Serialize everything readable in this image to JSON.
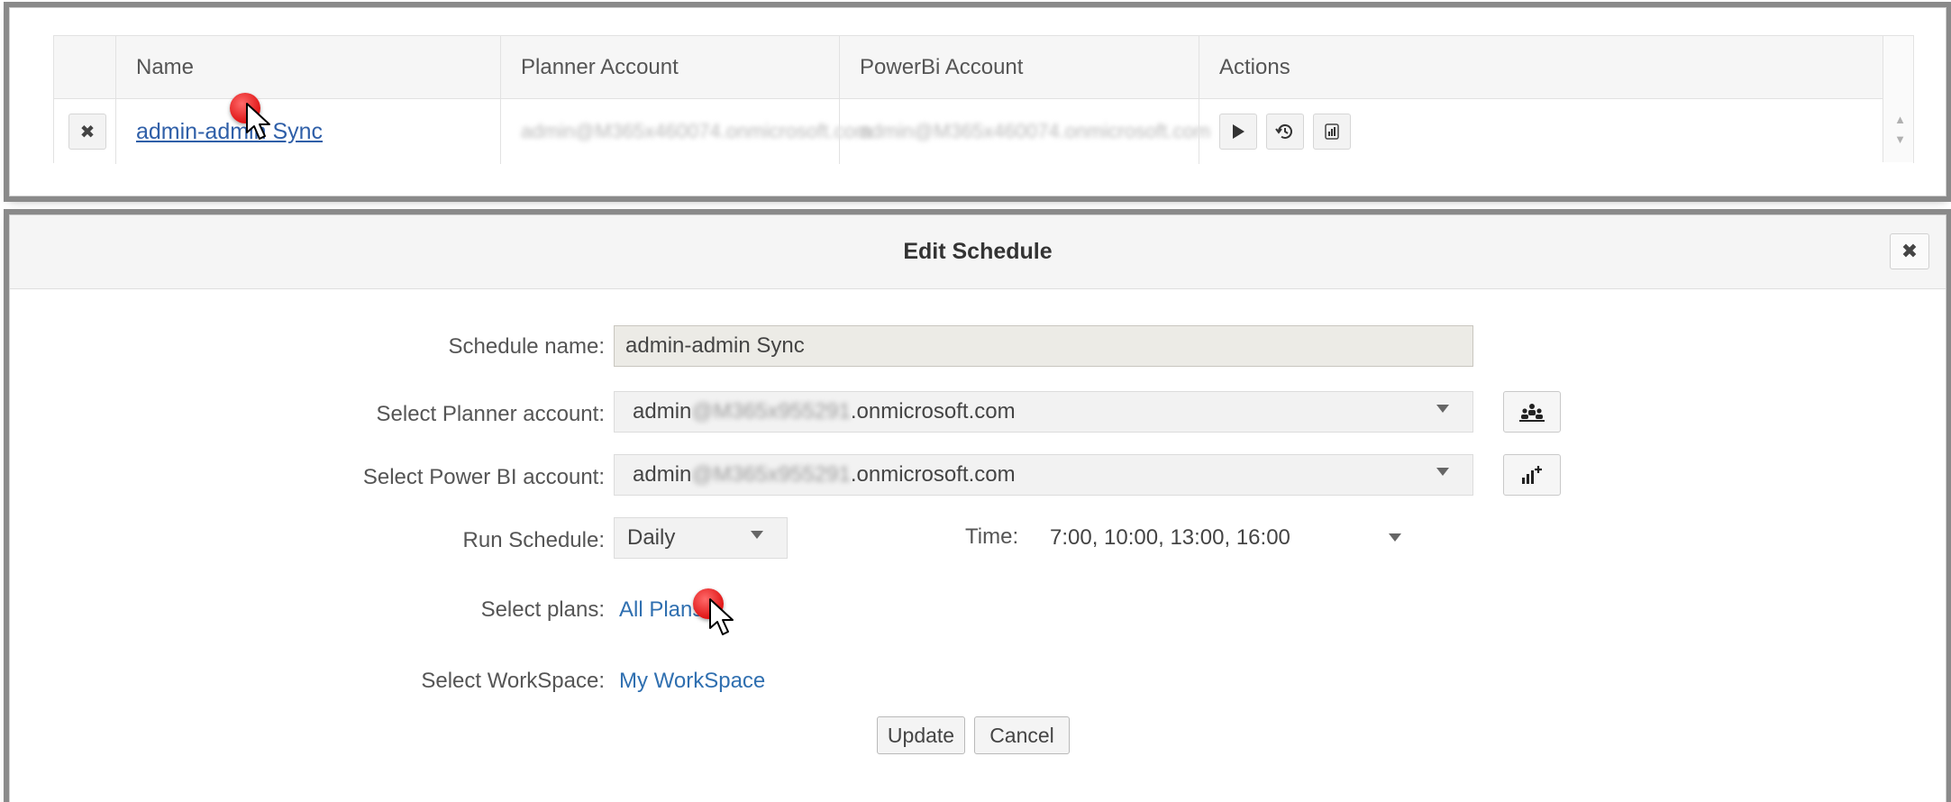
{
  "grid": {
    "columns": [
      "Name",
      "Planner Account",
      "PowerBi Account",
      "Actions"
    ],
    "row": {
      "name": "admin-admin Sync",
      "planner_account": "admin@M365x460074.onmicrosoft.com",
      "powerbi_account": "admin@M365x460074.onmicrosoft.com"
    },
    "icons": {
      "delete": "close-icon",
      "run": "play-icon",
      "history": "history-icon",
      "report": "powerbi-icon"
    }
  },
  "dialog": {
    "title": "Edit Schedule",
    "close_icon": "close-icon",
    "schedule_name_label": "Schedule name:",
    "schedule_name_value": "admin-admin Sync",
    "planner_label": "Select Planner account:",
    "planner_prefix": "admin",
    "planner_blur": "@M365x955291",
    "planner_suffix": ".onmicrosoft.com",
    "powerbi_label": "Select Power BI account:",
    "powerbi_prefix": "admin",
    "powerbi_blur": "@M365x955291",
    "powerbi_suffix": ".onmicrosoft.com",
    "run_schedule_label": "Run Schedule:",
    "run_schedule_value": "Daily",
    "time_label": "Time:",
    "time_value": "7:00, 10:00, 13:00, 16:00",
    "plans_label": "Select plans:",
    "plans_value": "All Plans",
    "workspace_label": "Select WorkSpace:",
    "workspace_value": "My WorkSpace",
    "update_label": "Update",
    "cancel_label": "Cancel"
  },
  "colors": {
    "link": "#2f6fb0",
    "cursor_dot": "#e01616"
  }
}
